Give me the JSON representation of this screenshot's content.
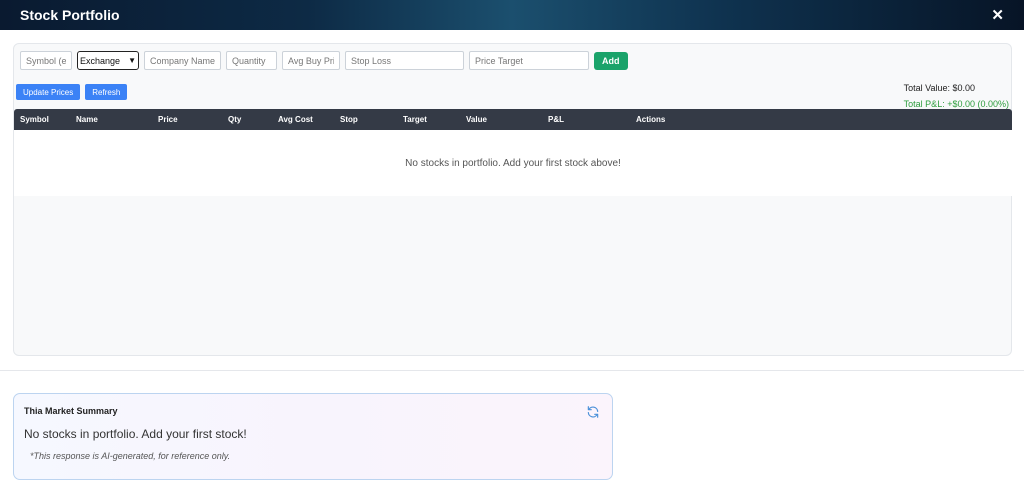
{
  "header": {
    "title": "Stock Portfolio",
    "close_icon": "close-icon"
  },
  "form": {
    "symbol_placeholder": "Symbol (e.g. AAPL)",
    "exchange_selected": "Exchange",
    "company_placeholder": "Company Name",
    "quantity_placeholder": "Quantity",
    "avg_buy_placeholder": "Avg Buy Price",
    "stop_loss_placeholder": "Stop Loss",
    "price_target_placeholder": "Price Target",
    "add_label": "Add"
  },
  "toolbar": {
    "update_label": "Update Prices",
    "refresh_label": "Refresh"
  },
  "totals": {
    "value": "Total Value: $0.00",
    "pnl": "Total P&L: +$0.00 (0.00%)"
  },
  "table": {
    "columns": [
      "Symbol",
      "Name",
      "Price",
      "Qty",
      "Avg Cost",
      "Stop",
      "Target",
      "Value",
      "P&L",
      "Actions"
    ],
    "empty_message": "No stocks in portfolio. Add your first stock above!"
  },
  "summary": {
    "title": "Thia Market Summary",
    "message": "No stocks in portfolio. Add your first stock!",
    "note": "*This response is AI-generated, for reference only.",
    "refresh_icon": "refresh-icon"
  },
  "colors": {
    "accent_green": "#1aa36a",
    "accent_blue": "#3b82f6",
    "pnl_green": "#2e9e3e",
    "table_header": "#343a46"
  }
}
